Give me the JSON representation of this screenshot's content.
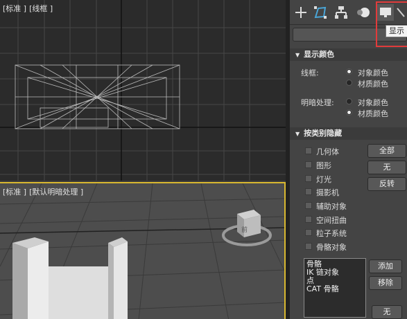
{
  "viewports": {
    "top": {
      "label_parts": [
        "[标准 ]",
        "[线框 ]"
      ]
    },
    "perspective": {
      "label_parts": [
        "[标准 ]",
        "[默认明暗处理 ]"
      ]
    }
  },
  "panel": {
    "tooltip": "显示",
    "display_color": {
      "header": "显示颜色",
      "wireframe_label": "线框:",
      "shaded_label": "明暗处理:",
      "option_object": "对象颜色",
      "option_material": "材质颜色",
      "wireframe_selected": "对象颜色",
      "shaded_selected": "材质颜色"
    },
    "hide_by_category": {
      "header": "按类别隐藏",
      "items": [
        "几何体",
        "图形",
        "灯光",
        "摄影机",
        "辅助对象",
        "空间扭曲",
        "粒子系统",
        "骨骼对象"
      ],
      "buttons": {
        "all": "全部",
        "none": "无",
        "invert": "反转"
      },
      "list": [
        "骨骼",
        "IK 链对象",
        "点",
        "CAT 骨骼"
      ],
      "add": "添加",
      "remove": "移除",
      "none2": "无"
    }
  },
  "gizmo_label": "前",
  "colors": {
    "accent_active": "#d9b830",
    "highlight": "#e23b3b"
  }
}
